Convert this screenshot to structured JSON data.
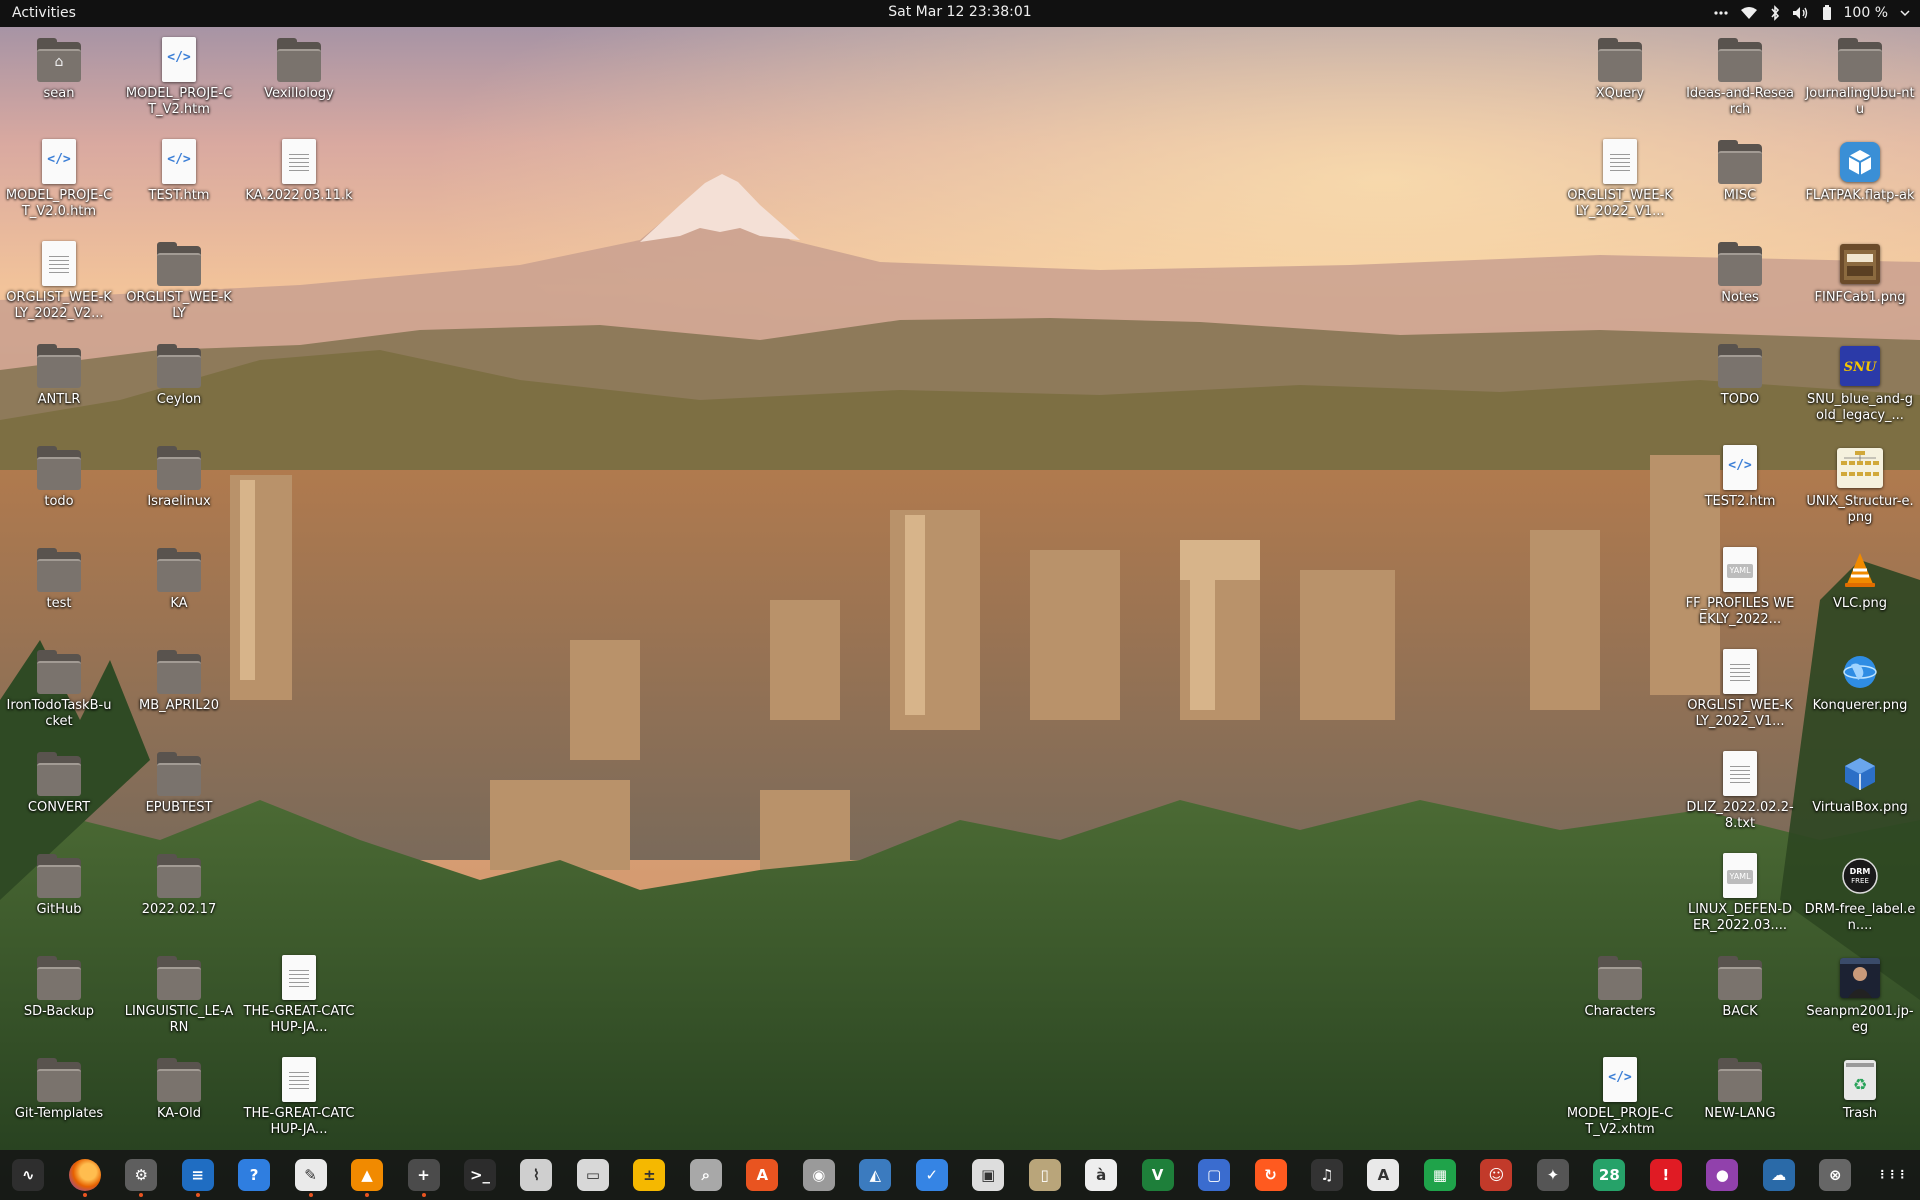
{
  "topbar": {
    "activities": "Activities",
    "clock": "Sat Mar 12  23:38:01",
    "overflow_icon": "more-dots",
    "wifi_icon": "wifi",
    "bluetooth_icon": "bluetooth",
    "volume_icon": "speaker",
    "battery_icon": "battery",
    "battery_percent": "100 %"
  },
  "desktop": {
    "icons": [
      {
        "id": "sean",
        "label": "sean",
        "type": "home"
      },
      {
        "id": "model1",
        "label": "MODEL_PROJE-CT_V2.htm",
        "type": "html"
      },
      {
        "id": "vex",
        "label": "Vexillology",
        "type": "folder"
      },
      {
        "id": "model2",
        "label": "MODEL_PROJE-CT_V2.0.htm",
        "type": "html"
      },
      {
        "id": "test",
        "label": "TEST.htm",
        "type": "html"
      },
      {
        "id": "ka2022",
        "label": "KA.2022.03.11.k",
        "type": "text"
      },
      {
        "id": "orglist1",
        "label": "ORGLIST_WEE-KLY_2022_V2...",
        "type": "text"
      },
      {
        "id": "orglist2",
        "label": "ORGLIST_WEE-KLY",
        "type": "folder"
      },
      {
        "id": "antlr",
        "label": "ANTLR",
        "type": "folder"
      },
      {
        "id": "ceylon",
        "label": "Ceylon",
        "type": "folder"
      },
      {
        "id": "todo",
        "label": "todo",
        "type": "folder"
      },
      {
        "id": "israel",
        "label": "Israelinux",
        "type": "folder"
      },
      {
        "id": "testf",
        "label": "test",
        "type": "folder"
      },
      {
        "id": "ka",
        "label": "KA",
        "type": "folder"
      },
      {
        "id": "irontodo",
        "label": "IronTodoTaskB-ucket",
        "type": "folder"
      },
      {
        "id": "mbapril",
        "label": "MB_APRIL20",
        "type": "folder"
      },
      {
        "id": "convert",
        "label": "CONVERT",
        "type": "folder"
      },
      {
        "id": "epubtest",
        "label": "EPUBTEST",
        "type": "folder"
      },
      {
        "id": "github",
        "label": "GitHub",
        "type": "folder"
      },
      {
        "id": "d20220217",
        "label": "2022.02.17",
        "type": "folder"
      },
      {
        "id": "sdbackup",
        "label": "SD-Backup",
        "type": "folder"
      },
      {
        "id": "linguistic",
        "label": "LINGUISTIC_LE-ARN",
        "type": "folder"
      },
      {
        "id": "great1",
        "label": "THE-GREAT-CATCHUP-JA...",
        "type": "text"
      },
      {
        "id": "gittemplates",
        "label": "Git-Templates",
        "type": "folder"
      },
      {
        "id": "kaold",
        "label": "KA-Old",
        "type": "folder"
      },
      {
        "id": "great2",
        "label": "THE-GREAT-CATCHUP-JA...",
        "type": "text"
      },
      {
        "id": "xquery",
        "label": "XQuery",
        "type": "folder"
      },
      {
        "id": "ideas",
        "label": "Ideas-and-Research",
        "type": "folder"
      },
      {
        "id": "journaling",
        "label": "JournalingUbu-ntu",
        "type": "folder"
      },
      {
        "id": "orglist3",
        "label": "ORGLIST_WEE-KLY_2022_V1...",
        "type": "text"
      },
      {
        "id": "misc",
        "label": "MISC",
        "type": "folder"
      },
      {
        "id": "flatpak",
        "label": "FLATPAK.flatp-ak",
        "type": "flatpak"
      },
      {
        "id": "notes",
        "label": "Notes",
        "type": "folder"
      },
      {
        "id": "finfcab",
        "label": "FINFCab1.png",
        "type": "image-cabinet"
      },
      {
        "id": "todo2",
        "label": "TODO",
        "type": "folder"
      },
      {
        "id": "snu",
        "label": "SNU_blue_and-gold_legacy_...",
        "type": "image-snu"
      },
      {
        "id": "test2",
        "label": "TEST2.htm",
        "type": "html"
      },
      {
        "id": "unix",
        "label": "UNIX_Structur-e.png",
        "type": "image-unix"
      },
      {
        "id": "ffprofiles",
        "label": "FF_PROFILES WEEKLY_2022...",
        "type": "yaml"
      },
      {
        "id": "vlcpng",
        "label": "VLC.png",
        "type": "image-vlc"
      },
      {
        "id": "orglist4",
        "label": "ORGLIST_WEE-KLY_2022_V1...",
        "type": "text"
      },
      {
        "id": "konqueror",
        "label": "Konquerer.png",
        "type": "image-globe"
      },
      {
        "id": "dliz",
        "label": "DLIZ_2022.02.2-8.txt",
        "type": "text"
      },
      {
        "id": "virtualbox",
        "label": "VirtualBox.png",
        "type": "image-vbox"
      },
      {
        "id": "linuxdef",
        "label": "LINUX_DEFEN-DER_2022.03....",
        "type": "yaml"
      },
      {
        "id": "drm",
        "label": "DRM-free_label.en....",
        "type": "image-drm"
      },
      {
        "id": "characters",
        "label": "Characters",
        "type": "folder"
      },
      {
        "id": "back",
        "label": "BACK",
        "type": "folder"
      },
      {
        "id": "seanpm",
        "label": "Seanpm2001.jp-eg",
        "type": "image-photo"
      },
      {
        "id": "model3",
        "label": "MODEL_PROJE-CT_V2.xhtm",
        "type": "html"
      },
      {
        "id": "newlang",
        "label": "NEW-LANG",
        "type": "folder"
      },
      {
        "id": "trash",
        "label": "Trash",
        "type": "trash"
      }
    ],
    "drm_text": "DRM FREE",
    "snu_text": "SNU",
    "yaml_text": "YAML"
  },
  "dock": {
    "apps": [
      {
        "name": "system-monitor",
        "glyph": "∿",
        "bg": "#2e2e2e"
      },
      {
        "name": "firefox",
        "glyph": "",
        "bg": "#e66000",
        "running": "1"
      },
      {
        "name": "settings",
        "glyph": "⚙",
        "bg": "#5e5e5e",
        "running": "1"
      },
      {
        "name": "text-document",
        "glyph": "≡",
        "bg": "#1f6dc2",
        "running": "1"
      },
      {
        "name": "help",
        "glyph": "?",
        "bg": "#2f7ee0"
      },
      {
        "name": "text-editor",
        "glyph": "✎",
        "bg": "#eaeaea",
        "running": "1"
      },
      {
        "name": "vlc",
        "glyph": "▲",
        "bg": "#f18a00",
        "running": "1"
      },
      {
        "name": "package-green",
        "glyph": "+",
        "bg": "#4b4b4b",
        "running": "1"
      },
      {
        "name": "terminal",
        "glyph": ">_",
        "bg": "#2c2c2c"
      },
      {
        "name": "resource-monitor",
        "glyph": "⌇",
        "bg": "#cfcfcf"
      },
      {
        "name": "files",
        "glyph": "▭",
        "bg": "#d8d8d8"
      },
      {
        "name": "calculator",
        "glyph": "±",
        "bg": "#f5b800"
      },
      {
        "name": "image-viewer",
        "glyph": "⌕",
        "bg": "#a8a8a8"
      },
      {
        "name": "software-center",
        "glyph": "A",
        "bg": "#e95420"
      },
      {
        "name": "disk-utility",
        "glyph": "◉",
        "bg": "#9a9a9a"
      },
      {
        "name": "document-viewer",
        "glyph": "◭",
        "bg": "#3b7bbf"
      },
      {
        "name": "todo",
        "glyph": "✓",
        "bg": "#3584e4"
      },
      {
        "name": "screenshot",
        "glyph": "▣",
        "bg": "#dddddd"
      },
      {
        "name": "archive-manager",
        "glyph": "▯",
        "bg": "#b9a57a"
      },
      {
        "name": "character-map",
        "glyph": "à",
        "bg": "#eeeeee"
      },
      {
        "name": "vim",
        "glyph": "V",
        "bg": "#1e7f3a"
      },
      {
        "name": "remote-desktop",
        "glyph": "▢",
        "bg": "#3a6ccf"
      },
      {
        "name": "backup",
        "glyph": "↻",
        "bg": "#ff5a1f"
      },
      {
        "name": "music",
        "glyph": "♫",
        "bg": "#333333"
      },
      {
        "name": "font-viewer",
        "glyph": "A",
        "bg": "#e9e9e9"
      },
      {
        "name": "spreadsheet",
        "glyph": "▦",
        "bg": "#1fa34a"
      },
      {
        "name": "retro-game",
        "glyph": "☺",
        "bg": "#c23a2a"
      },
      {
        "name": "system-tools",
        "glyph": "✦",
        "bg": "#555555"
      },
      {
        "name": "calendar",
        "glyph": "28",
        "bg": "#26a269"
      },
      {
        "name": "alert",
        "glyph": "!",
        "bg": "#e01b24"
      },
      {
        "name": "camera",
        "glyph": "●",
        "bg": "#9141ac"
      },
      {
        "name": "weather-map",
        "glyph": "☁",
        "bg": "#2a6aa8"
      },
      {
        "name": "update-manager",
        "glyph": "⊗",
        "bg": "#666666"
      },
      {
        "name": "show-applications",
        "glyph": "⋮⋮⋮",
        "bg": "transparent"
      }
    ]
  },
  "colors": {
    "topbar_bg": "#111111",
    "accent": "#e95420",
    "folder": "#7a736d"
  }
}
